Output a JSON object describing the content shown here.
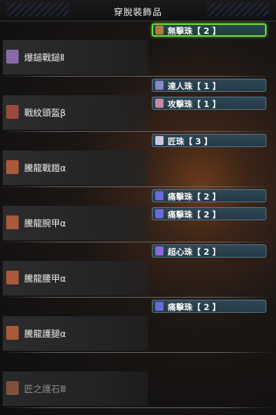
{
  "header": {
    "title": "穿脫裝飾品"
  },
  "equipment": [
    {
      "name": "爆鎚戰鎚Ⅱ",
      "icon": "hammer-icon",
      "icon_color": "#8a6aa8",
      "decorations": [
        {
          "label": "無擊珠【 2 】",
          "icon": "gem-icon",
          "icon_color": "#b07a3a",
          "selected": true
        }
      ]
    },
    {
      "name": "戰紋頭盔β",
      "icon": "helmet-icon",
      "icon_color": "#9a4a3a",
      "decorations": [
        {
          "label": "達人珠【 1 】",
          "icon": "gem-icon",
          "icon_color": "#8a88c8",
          "selected": false
        },
        {
          "label": "攻擊珠【 1 】",
          "icon": "gem-icon",
          "icon_color": "#c88aa0",
          "selected": false
        }
      ]
    },
    {
      "name": "騰龍戰鎧α",
      "icon": "chest-armor-icon",
      "icon_color": "#a85a3a",
      "decorations": [
        {
          "label": "匠珠【 3 】",
          "icon": "gem-icon",
          "icon_color": "#c8c8d8",
          "selected": false
        }
      ]
    },
    {
      "name": "騰龍腕甲α",
      "icon": "arm-armor-icon",
      "icon_color": "#a85a3a",
      "decorations": [
        {
          "label": "痛擊珠【 2 】",
          "icon": "gem-icon",
          "icon_color": "#6a6ad8",
          "selected": false
        },
        {
          "label": "痛擊珠【 2 】",
          "icon": "gem-icon",
          "icon_color": "#6a6ad8",
          "selected": false
        }
      ]
    },
    {
      "name": "騰龍腰甲α",
      "icon": "waist-armor-icon",
      "icon_color": "#a85a3a",
      "decorations": [
        {
          "label": "超心珠【 2 】",
          "icon": "gem-icon",
          "icon_color": "#8a6ad8",
          "selected": false
        }
      ]
    },
    {
      "name": "騰龍護腿α",
      "icon": "leg-armor-icon",
      "icon_color": "#a85a3a",
      "decorations": [
        {
          "label": "痛擊珠【 2 】",
          "icon": "gem-icon",
          "icon_color": "#6a6ad8",
          "selected": false
        }
      ]
    },
    {
      "name": "匠之護石Ⅲ",
      "icon": "charm-icon",
      "icon_color": "#8a5a40",
      "dim": true,
      "decorations": []
    }
  ],
  "colors": {
    "selected_border": "#6fdc3a",
    "slot_fill": "#2f4756",
    "slot_border": "#57798c"
  }
}
